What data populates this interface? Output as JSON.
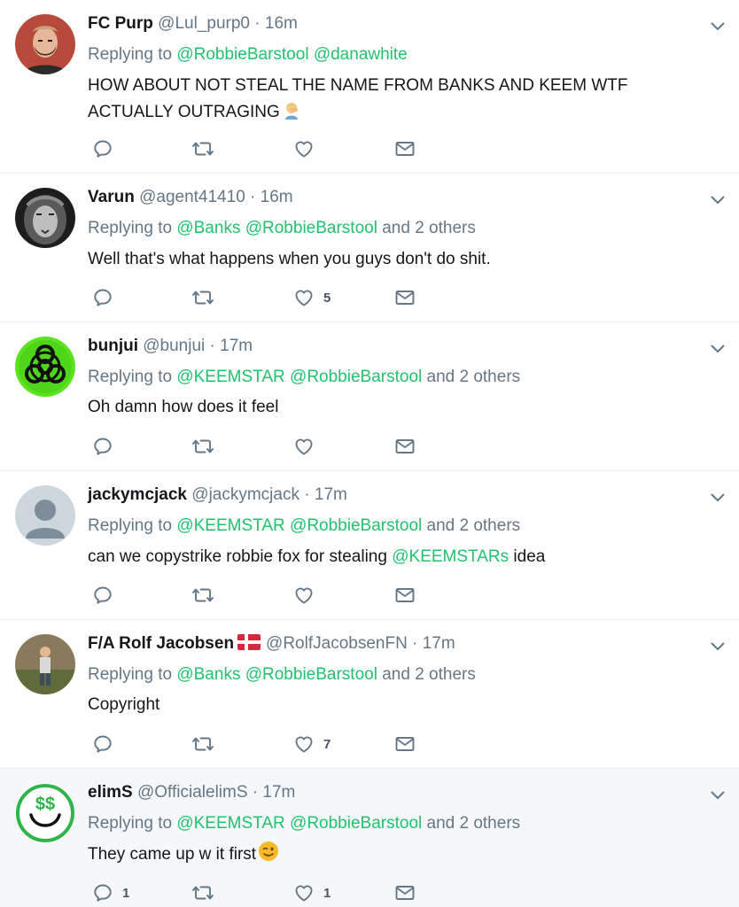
{
  "tweets": [
    {
      "name": "FC Purp",
      "handle": "@Lul_purp0",
      "time": "16m",
      "replying_prefix": "Replying to",
      "mentions": [
        "@RobbieBarstool",
        "@danawhite"
      ],
      "others": "",
      "body_lines": [
        "HOW ABOUT NOT STEAL THE NAME FROM BANKS AND KEEM WTF",
        "ACTUALLY OUTRAGING"
      ],
      "reply_count": "",
      "like_count": ""
    },
    {
      "name": "Varun",
      "handle": "@agent41410",
      "time": "16m",
      "replying_prefix": "Replying to",
      "mentions": [
        "@Banks",
        "@RobbieBarstool"
      ],
      "others": "and 2 others",
      "body_lines": [
        "Well that's what happens when you guys don't do shit."
      ],
      "reply_count": "",
      "like_count": "5"
    },
    {
      "name": "bunjui",
      "handle": "@bunjui",
      "time": "17m",
      "replying_prefix": "Replying to",
      "mentions": [
        "@KEEMSTAR",
        "@RobbieBarstool"
      ],
      "others": "and 2 others",
      "body_lines": [
        "Oh damn how does it feel"
      ],
      "reply_count": "",
      "like_count": ""
    },
    {
      "name": "jackymcjack",
      "handle": "@jackymcjack",
      "time": "17m",
      "replying_prefix": "Replying to",
      "mentions": [
        "@KEEMSTAR",
        "@RobbieBarstool"
      ],
      "others": "and 2 others",
      "body_pre": "can we copystrike robbie fox for stealing ",
      "body_mention": "@KEEMSTARs",
      "body_post": " idea",
      "reply_count": "",
      "like_count": ""
    },
    {
      "name": "F/A Rolf Jacobsen",
      "handle": "@RolfJacobsenFN",
      "time": "17m",
      "replying_prefix": "Replying to",
      "mentions": [
        "@Banks",
        "@RobbieBarstool"
      ],
      "others": "and 2 others",
      "body_lines": [
        "Copyright"
      ],
      "reply_count": "",
      "like_count": "7"
    },
    {
      "name": "elimS",
      "handle": "@OfficialelimS",
      "time": "17m",
      "replying_prefix": "Replying to",
      "mentions": [
        "@KEEMSTAR",
        "@RobbieBarstool"
      ],
      "others": "and 2 others",
      "body_lines": [
        "They came up w it first"
      ],
      "reply_count": "1",
      "like_count": "1"
    }
  ],
  "separator": "·",
  "icons": [
    "chevron-down-icon",
    "reply-icon",
    "retweet-icon",
    "like-icon",
    "direct-message-icon",
    "flag-denmark-icon",
    "winking-face-emoji",
    "person-facepalming-emoji"
  ],
  "colors": {
    "mention": "#22c16d",
    "meta": "#657786",
    "text": "#14171a",
    "divider": "#e6ecf0"
  }
}
